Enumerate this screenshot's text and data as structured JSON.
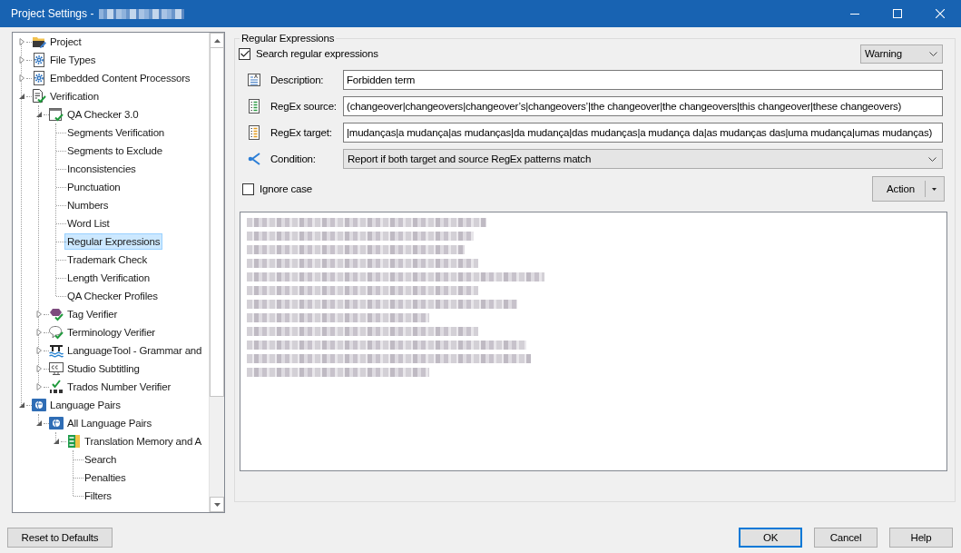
{
  "window": {
    "title": "Project Settings -"
  },
  "tree": {
    "items": [
      {
        "label": "Project",
        "kind": "project",
        "expanded": false,
        "selected": false
      },
      {
        "label": "File Types",
        "kind": "settings",
        "expanded": false,
        "selected": false
      },
      {
        "label": "Embedded Content Processors",
        "kind": "settings",
        "expanded": false,
        "selected": false
      },
      {
        "label": "Verification",
        "kind": "verification",
        "expanded": true,
        "selected": false,
        "children": [
          {
            "label": "QA Checker 3.0",
            "kind": "checker",
            "expanded": true,
            "selected": false,
            "children": [
              {
                "label": "Segments Verification",
                "kind": "page",
                "selected": false
              },
              {
                "label": "Segments to Exclude",
                "kind": "page",
                "selected": false
              },
              {
                "label": "Inconsistencies",
                "kind": "page",
                "selected": false
              },
              {
                "label": "Punctuation",
                "kind": "page",
                "selected": false
              },
              {
                "label": "Numbers",
                "kind": "page",
                "selected": false
              },
              {
                "label": "Word List",
                "kind": "page",
                "selected": false
              },
              {
                "label": "Regular Expressions",
                "kind": "page",
                "selected": true
              },
              {
                "label": "Trademark Check",
                "kind": "page",
                "selected": false
              },
              {
                "label": "Length Verification",
                "kind": "page",
                "selected": false
              },
              {
                "label": "QA Checker Profiles",
                "kind": "page",
                "selected": false
              }
            ]
          },
          {
            "label": "Tag Verifier",
            "kind": "tag",
            "expanded": false,
            "selected": false
          },
          {
            "label": "Terminology Verifier",
            "kind": "terminology",
            "expanded": false,
            "selected": false
          },
          {
            "label": "LanguageTool - Grammar and",
            "kind": "grammar",
            "expanded": false,
            "selected": false
          },
          {
            "label": "Studio Subtitling",
            "kind": "subtitles",
            "expanded": false,
            "selected": false
          },
          {
            "label": "Trados Number Verifier",
            "kind": "numbers",
            "expanded": false,
            "selected": false
          }
        ]
      },
      {
        "label": "Language Pairs",
        "kind": "languages",
        "expanded": true,
        "selected": false,
        "children": [
          {
            "label": "All Language Pairs",
            "kind": "languages",
            "expanded": true,
            "selected": false,
            "children": [
              {
                "label": "Translation Memory and A",
                "kind": "memory",
                "expanded": true,
                "selected": false,
                "children": [
                  {
                    "label": "Search",
                    "kind": "page",
                    "selected": false
                  },
                  {
                    "label": "Penalties",
                    "kind": "page",
                    "selected": false
                  },
                  {
                    "label": "Filters",
                    "kind": "page",
                    "selected": false
                  }
                ]
              }
            ]
          }
        ]
      }
    ]
  },
  "regex_panel": {
    "title": "Regular Expressions",
    "search": {
      "label": "Search regular expressions",
      "checked": true
    },
    "severity": {
      "value": "Warning"
    },
    "fields": [
      {
        "kind": "description",
        "label": "Description:",
        "value": "Forbidden term"
      },
      {
        "kind": "source",
        "label": "RegEx source:",
        "value": "(changeover|changeovers|changeover’s|changeovers’|the changeover|the changeovers|this changeover|these changeovers)"
      },
      {
        "kind": "target",
        "label": "RegEx target:",
        "value": "|mudanças|a mudança|as mudanças|da mudança|das mudanças|a mudança da|as mudanças das|uma mudança|umas mudanças)"
      },
      {
        "kind": "condition",
        "label": "Condition:",
        "value": "Report if both target and source RegEx patterns match"
      }
    ],
    "ignore_case": {
      "label": "Ignore case",
      "checked": false
    },
    "action_button": {
      "label": "Action"
    }
  },
  "footer": {
    "reset_button": {
      "label": "Reset to Defaults"
    },
    "buttons": [
      {
        "label": "OK",
        "default": true
      },
      {
        "label": "Cancel",
        "default": false
      },
      {
        "label": "Help",
        "default": false
      }
    ]
  }
}
